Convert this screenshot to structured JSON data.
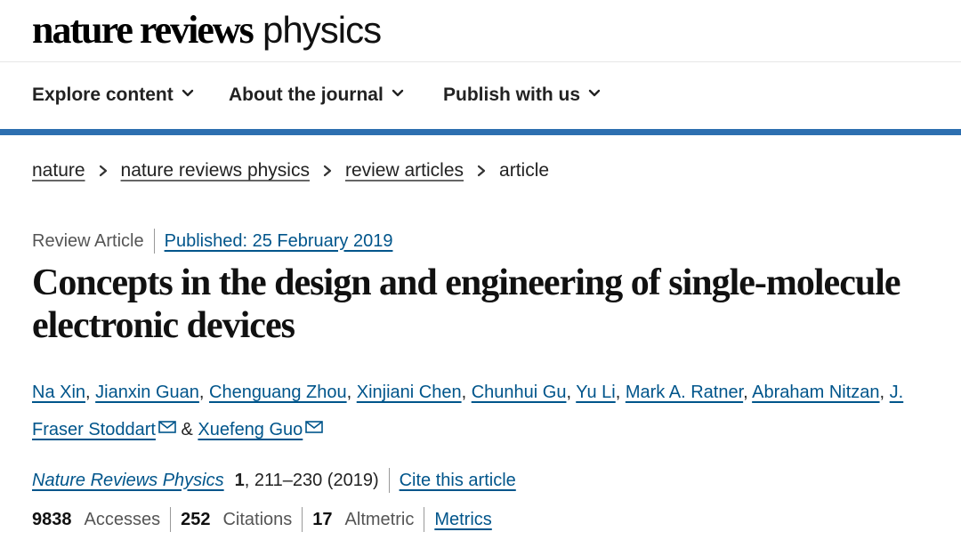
{
  "header": {
    "logo_bold": "nature reviews",
    "logo_light": "physics"
  },
  "nav": {
    "items": [
      {
        "label": "Explore content",
        "icon": "chevron-down-icon"
      },
      {
        "label": "About the journal",
        "icon": "chevron-down-icon"
      },
      {
        "label": "Publish with us",
        "icon": "chevron-down-icon"
      }
    ]
  },
  "breadcrumb": {
    "items": [
      "nature",
      "nature reviews physics",
      "review articles"
    ],
    "current": "article"
  },
  "article": {
    "type": "Review Article",
    "published": "Published: 25 February 2019",
    "title": "Concepts in the design and engineering of single-molecule electronic devices",
    "authors": [
      "Na Xin",
      "Jianxin Guan",
      "Chenguang Zhou",
      "Xinjiani Chen",
      "Chunhui Gu",
      "Yu Li",
      "Mark A. Ratner",
      "Abraham Nitzan",
      "J. Fraser Stoddart",
      "Xuefeng Guo"
    ],
    "author_separator": ",",
    "author_conjunction": "&",
    "journal": "Nature Reviews Physics",
    "volume": "1",
    "pages_year": ", 211–230 (2019)",
    "cite_label": "Cite this article"
  },
  "metrics": {
    "accesses_value": "9838",
    "accesses_label": "Accesses",
    "citations_value": "252",
    "citations_label": "Citations",
    "altmetric_value": "17",
    "altmetric_label": "Altmetric",
    "metrics_link": "Metrics"
  },
  "colors": {
    "accent_bar": "#2d6fb0",
    "link": "#00558b"
  }
}
